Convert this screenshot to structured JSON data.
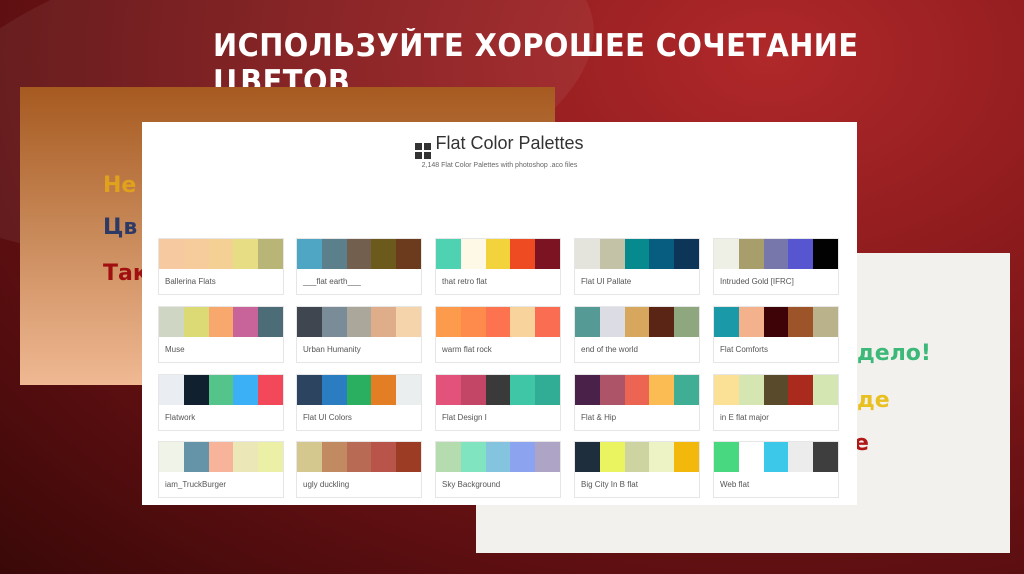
{
  "slide_title": "ИСПОЛЬЗУЙТЕ ХОРОШЕЕ СОЧЕТАНИЕ ЦВЕТОВ",
  "left_panel": {
    "lines": [
      {
        "text": "Не",
        "color": "#e0a21c"
      },
      {
        "text": "Цв",
        "color": "#2e3a66"
      },
      {
        "text": "Так",
        "color": "#a01010"
      }
    ]
  },
  "right_panel": {
    "lines": [
      {
        "text": "дело!",
        "color": "#3cb878"
      },
      {
        "text": "де",
        "color": "#e8c020"
      },
      {
        "text": "е",
        "color": "#b01818"
      }
    ]
  },
  "site": {
    "title": "Flat Color Palettes",
    "subtitle": "2,148 Flat Color Palettes with photoshop .aco files"
  },
  "palettes": [
    {
      "name": "Ballerina Flats",
      "colors": [
        "#f6c9a0",
        "#f7cc9c",
        "#f4d094",
        "#e7dd85",
        "#b9b577"
      ]
    },
    {
      "name": "___flat earth___",
      "colors": [
        "#4ea5c4",
        "#5c7f8c",
        "#725f4e",
        "#6b5a1c",
        "#6c3a1c"
      ]
    },
    {
      "name": "that retro flat",
      "colors": [
        "#4fd2b2",
        "#fdf9e6",
        "#f2d33c",
        "#ef4b22",
        "#7c1323"
      ]
    },
    {
      "name": "Flat UI Pallate",
      "colors": [
        "#e4e4dc",
        "#c4c2a6",
        "#078a8d",
        "#065d80",
        "#0d3558"
      ]
    },
    {
      "name": "Intruded Gold [IFRC]",
      "colors": [
        "#eef0e6",
        "#a79e6c",
        "#7877ab",
        "#5755cf",
        "#020202"
      ]
    },
    {
      "name": "Muse",
      "colors": [
        "#cfd6c4",
        "#dcda74",
        "#f8a86c",
        "#c8649a",
        "#4c6d78"
      ]
    },
    {
      "name": "Urban Humanity",
      "colors": [
        "#3f4650",
        "#7a8c98",
        "#aba79a",
        "#e0ad8a",
        "#f5d4ac"
      ]
    },
    {
      "name": "warm flat rock",
      "colors": [
        "#fd9b4d",
        "#fe8a4b",
        "#fd734f",
        "#f8d49c",
        "#fb6d52"
      ]
    },
    {
      "name": "end of the world",
      "colors": [
        "#559a94",
        "#dcdce5",
        "#d6a75c",
        "#5a2514",
        "#8fa77e"
      ]
    },
    {
      "name": "Flat Comforts",
      "colors": [
        "#1a9aa8",
        "#f3b28c",
        "#3e0306",
        "#9c5428",
        "#b9b28a"
      ]
    },
    {
      "name": "Flatwork",
      "colors": [
        "#eaeef2",
        "#11202e",
        "#55c48a",
        "#3cb0f6",
        "#f3485a"
      ]
    },
    {
      "name": "Flat UI Colors",
      "colors": [
        "#2c4460",
        "#2a7dc0",
        "#2aae5f",
        "#e47e24",
        "#ebeeef"
      ]
    },
    {
      "name": "Flat Design I",
      "colors": [
        "#e2527a",
        "#c44666",
        "#3a3a3a",
        "#3fc6a6",
        "#32ad95"
      ]
    },
    {
      "name": "Flat & Hip",
      "colors": [
        "#4a2148",
        "#ae5469",
        "#ec6553",
        "#fbbc54",
        "#40ad95"
      ]
    },
    {
      "name": "in E flat major",
      "colors": [
        "#fae196",
        "#d6e6b2",
        "#584a2a",
        "#aa2a1e",
        "#d4e6b2"
      ]
    },
    {
      "name": "iam_TruckBurger",
      "colors": [
        "#f0f4e8",
        "#6593a8",
        "#f7b49a",
        "#ebe7b6",
        "#ecf0a6"
      ]
    },
    {
      "name": "ugly duckling",
      "colors": [
        "#d4c88e",
        "#c28a60",
        "#b96a54",
        "#b9544a",
        "#9c3c24"
      ]
    },
    {
      "name": "Sky Background",
      "colors": [
        "#b4dcae",
        "#80e4c0",
        "#84c4de",
        "#8ca4f0",
        "#aea4c6"
      ]
    },
    {
      "name": "Big City In B flat",
      "colors": [
        "#1f2e3c",
        "#eaf460",
        "#cdd4a2",
        "#eef3c6",
        "#f3b80c"
      ]
    },
    {
      "name": "Web flat",
      "colors": [
        "#48d880",
        "#ffffff",
        "#3cc8e8",
        "#ececec",
        "#3e3e3e"
      ]
    }
  ]
}
